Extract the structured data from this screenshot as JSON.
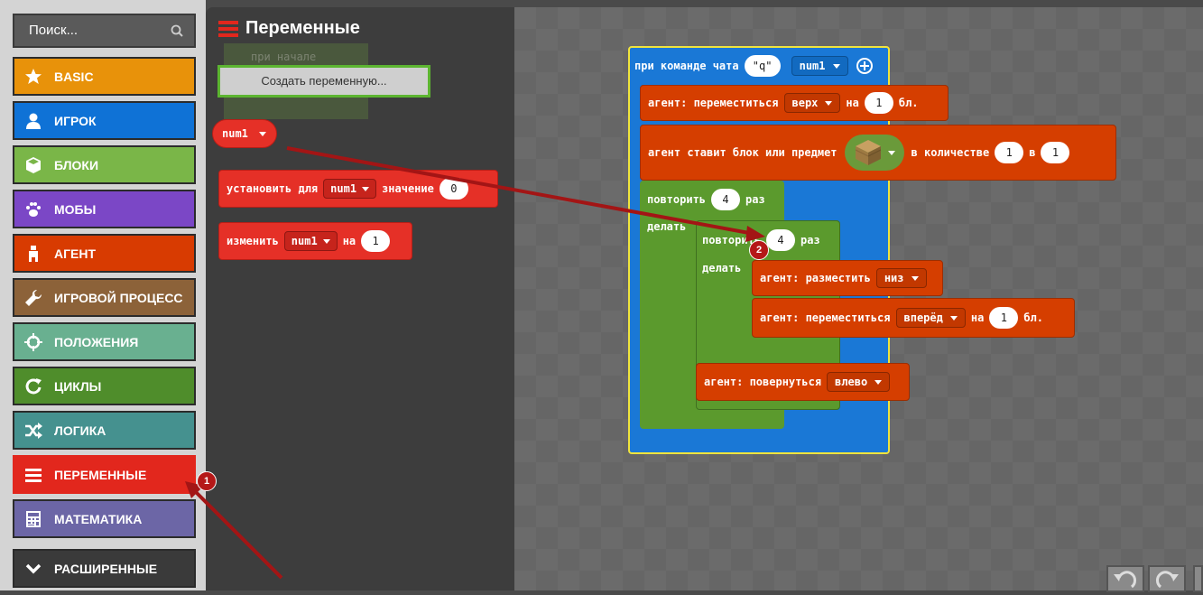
{
  "search": {
    "placeholder": "Поиск..."
  },
  "categories": [
    {
      "label": "BASIC",
      "color": "#e8920a",
      "icon": "star-icon"
    },
    {
      "label": "ИГРОК",
      "color": "#0f72d6",
      "icon": "person-icon"
    },
    {
      "label": "БЛОКИ",
      "color": "#7ab648",
      "icon": "cube-icon"
    },
    {
      "label": "МОБЫ",
      "color": "#7b47c6",
      "icon": "paw-icon"
    },
    {
      "label": "АГЕНТ",
      "color": "#d83b01",
      "icon": "agent-icon"
    },
    {
      "label": "ИГРОВОЙ ПРОЦЕСС",
      "color": "#8c6239",
      "icon": "wrench-icon"
    },
    {
      "label": "ПОЛОЖЕНИЯ",
      "color": "#69b090",
      "icon": "crosshair-icon"
    },
    {
      "label": "ЦИКЛЫ",
      "color": "#4f8d2b",
      "icon": "loop-icon"
    },
    {
      "label": "ЛОГИКА",
      "color": "#45918f",
      "icon": "shuffle-icon"
    },
    {
      "label": "ПЕРЕМЕННЫЕ",
      "color": "#e2271d",
      "icon": "list-icon"
    },
    {
      "label": "МАТЕМАТИКА",
      "color": "#6c66a6",
      "icon": "calculator-icon"
    },
    {
      "label": "РАСШИРЕННЫЕ",
      "color": "#3a3a3a",
      "icon": "chevron-down-icon"
    }
  ],
  "flyout": {
    "title": "Переменные",
    "ghost_text": "при начале",
    "create_button": "Создать переменную...",
    "var_name": "num1",
    "set_block": {
      "prefix": "установить для",
      "var": "num1",
      "mid": "значение",
      "value": "0"
    },
    "change_block": {
      "prefix": "изменить",
      "var": "num1",
      "mid": "на",
      "value": "1"
    }
  },
  "workspace": {
    "event": {
      "label": "при команде чата",
      "command": "\"q\"",
      "var": "num1"
    },
    "move1": {
      "label": "агент: переместиться",
      "dir": "верх",
      "on": "на",
      "n": "1",
      "unit": "бл."
    },
    "place": {
      "label": "агент ставит блок или предмет",
      "qty_label": "в количестве",
      "qty": "1",
      "in": "в",
      "slot": "1"
    },
    "repeat_outer": {
      "label": "повторить",
      "n": "4",
      "times": "раз",
      "do": "делать"
    },
    "repeat_inner": {
      "label": "повторить",
      "n": "4",
      "times": "раз",
      "do": "делать"
    },
    "place2": {
      "label": "агент: разместить",
      "dir": "низ"
    },
    "move2": {
      "label": "агент: переместиться",
      "dir": "вперёд",
      "on": "на",
      "n": "1",
      "unit": "бл."
    },
    "turn": {
      "label": "агент: повернуться",
      "dir": "влево"
    }
  },
  "annotations": {
    "badge1": "1",
    "badge2": "2"
  }
}
